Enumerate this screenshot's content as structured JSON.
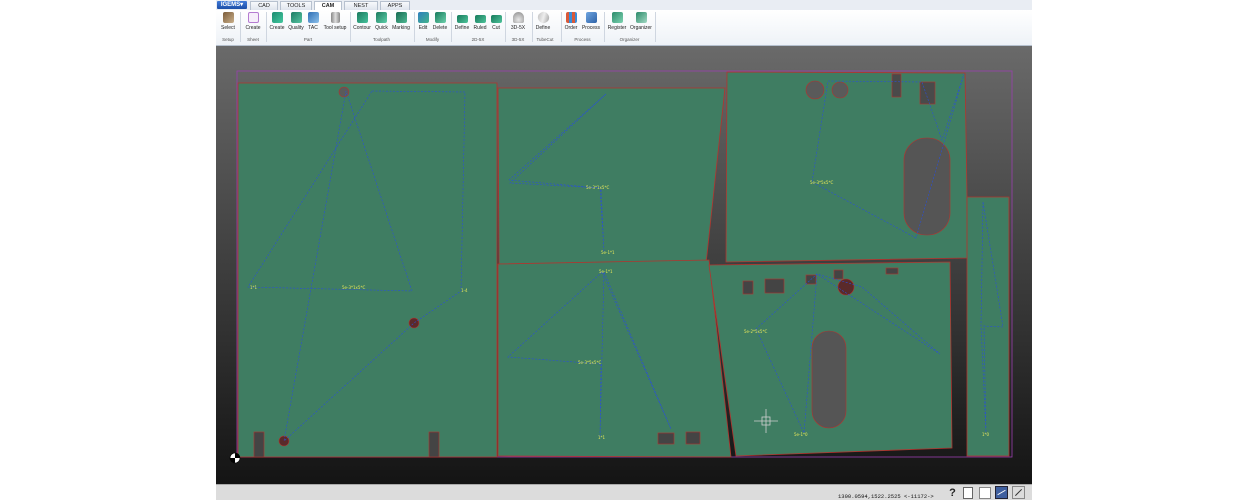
{
  "menu": {
    "app_button": "IGEMS▾"
  },
  "tabs": [
    {
      "label": "CAD"
    },
    {
      "label": "TOOLS"
    },
    {
      "label": "CAM",
      "active": true
    },
    {
      "label": "NEST"
    },
    {
      "label": "APPS"
    }
  ],
  "ribbon": {
    "buttons": {
      "select": "Select",
      "create_sheet": "Create",
      "create_part": "Create",
      "quality": "Quality",
      "tac": "TAC",
      "tool_setup": "Tool setup",
      "contour": "Contour",
      "quick": "Quick",
      "marking": "Marking",
      "edit": "Edit",
      "delete": "Delete",
      "define_2d": "Define",
      "ruled": "Ruled",
      "cut": "Cut",
      "btn_3d5x": "3D-5X",
      "define_tube": "Define",
      "order": "Order",
      "process": "Process",
      "register": "Register",
      "organizer": "Organizer"
    },
    "groups": {
      "setup": "Setup",
      "sheet": "Sheet",
      "part": "Part",
      "toolpath": "Toolpath",
      "modify": "Modify",
      "g2d5x": "2D-5X",
      "g3d5x": "3D-5X",
      "tubecut": "TubeCut",
      "process": "Process",
      "organizer": "Organizer"
    }
  },
  "status": {
    "coords": "1300.0594,1522.2525 <-11172->",
    "help_icon_text": "?"
  },
  "colors": {
    "part_fill": "#3f7d62",
    "part_edge": "#b3342e",
    "toolpath": "#2a4fd8",
    "sheet_border": "#9a3fb0",
    "canvas_top": "#6a6a6a",
    "canvas_bottom": "#141414"
  }
}
